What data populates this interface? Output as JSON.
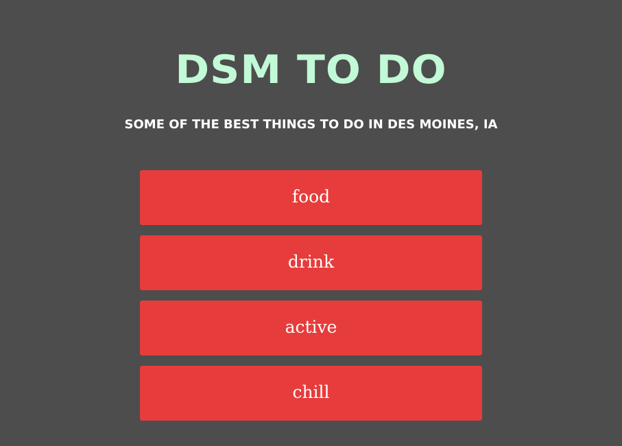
{
  "header": {
    "title": "DSM TO DO",
    "subtitle": "SOME OF THE BEST THINGS TO DO IN DES MOINES, IA"
  },
  "menu": {
    "items": [
      {
        "label": "food"
      },
      {
        "label": "drink"
      },
      {
        "label": "active"
      },
      {
        "label": "chill"
      }
    ]
  },
  "colors": {
    "background": "#4d4d4d",
    "title": "#c2f9d6",
    "subtitle": "#ffffff",
    "button": "#e73c3c",
    "button_text": "#ffffff"
  }
}
